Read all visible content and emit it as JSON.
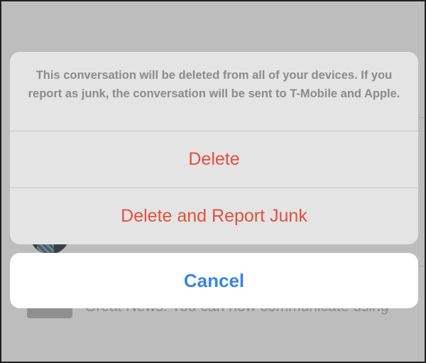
{
  "background": {
    "preview_text": "Great News! You can now communicate using"
  },
  "action_sheet": {
    "message": "This conversation will be deleted from all of your devices. If you report as junk, the conversation will be sent to T-Mobile and Apple.",
    "actions": [
      {
        "label": "Delete",
        "color": "#e2503f"
      },
      {
        "label": "Delete and Report Junk",
        "color": "#e2503f"
      }
    ],
    "cancel_label": "Cancel",
    "cancel_color": "#3a85e1"
  }
}
